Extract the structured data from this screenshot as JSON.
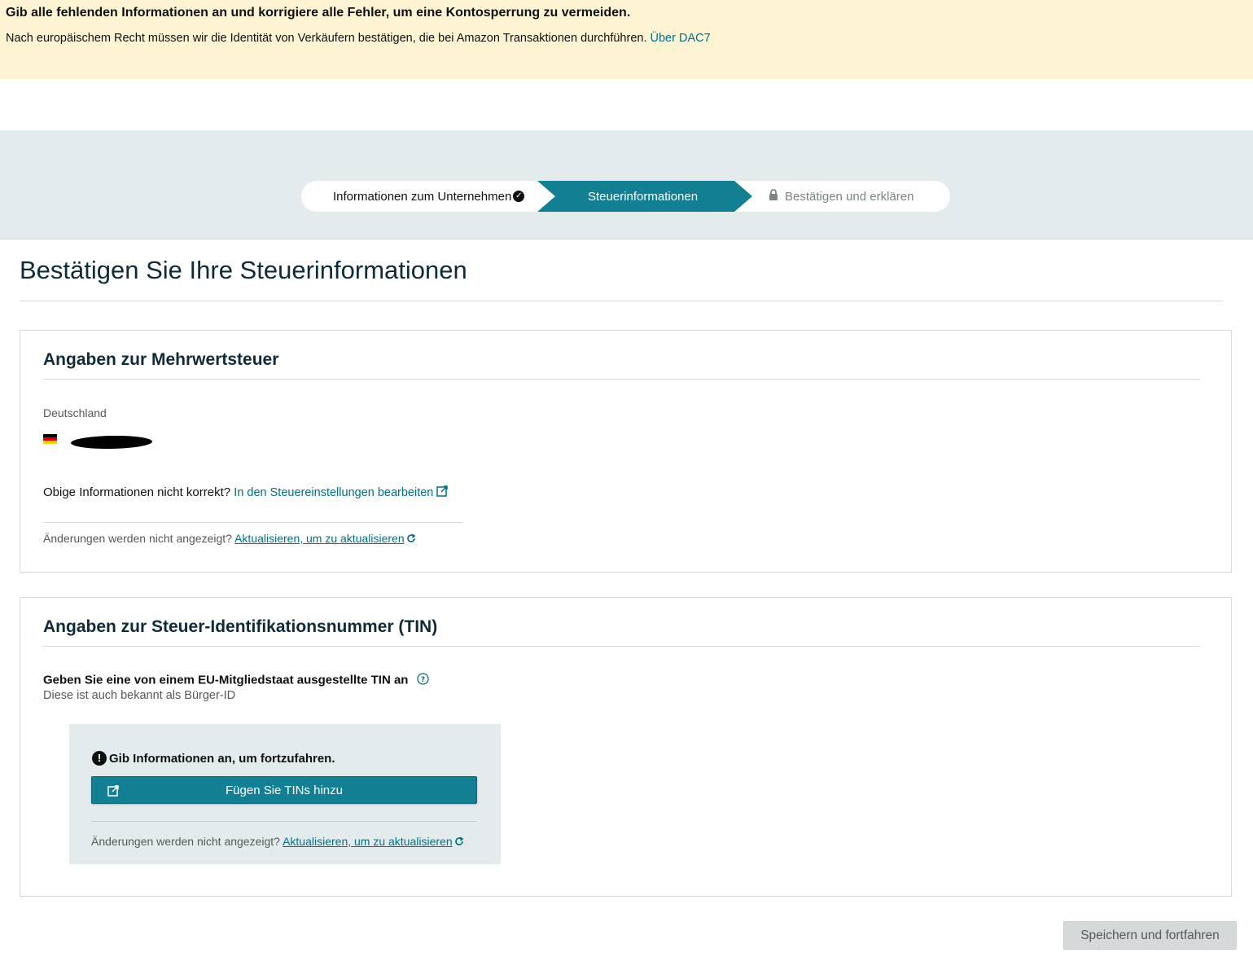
{
  "banner": {
    "title": "Gib alle fehlenden Informationen an und korrigiere alle Fehler, um eine Kontosperrung zu vermeiden.",
    "body": "Nach europäischem Recht müssen wir die Identität von Verkäufern bestätigen, die bei Amazon Transaktionen durchführen.",
    "link": "Über DAC7"
  },
  "stepper": {
    "steps": [
      {
        "label": "Informationen zum Unternehmen",
        "state": "completed"
      },
      {
        "label": "Steuerinformationen",
        "state": "active"
      },
      {
        "label": "Bestätigen und erklären",
        "state": "locked"
      }
    ],
    "active_color": "#137f92"
  },
  "page": {
    "title": "Bestätigen Sie Ihre Steuerinformationen"
  },
  "vat": {
    "heading": "Angaben zur Mehrwertsteuer",
    "country": "Deutschland",
    "incorrect_text": "Obige Informationen nicht korrekt?",
    "edit_link": "In den Steuereinstellungen bearbeiten",
    "changes_text": "Änderungen werden nicht angezeigt?",
    "refresh_link": "Aktualisieren, um zu aktualisieren"
  },
  "tin": {
    "heading": "Angaben zur Steuer-Identifikationsnummer (TIN)",
    "prompt": "Geben Sie eine von einem EU-Mitgliedstaat ausgestellte TIN an",
    "subtext": "Diese ist auch bekannt als Bürger-ID",
    "alert": "Gib Informationen an, um fortzufahren.",
    "add_button": "Fügen Sie TINs hinzu",
    "changes_text": "Änderungen werden nicht angezeigt?",
    "refresh_link": "Aktualisieren, um zu aktualisieren"
  },
  "footer": {
    "save_button": "Speichern und fortfahren"
  },
  "colors": {
    "banner_bg": "#fef4d3",
    "link": "#007185",
    "primary": "#137f92",
    "band_bg": "#e3ebec"
  }
}
